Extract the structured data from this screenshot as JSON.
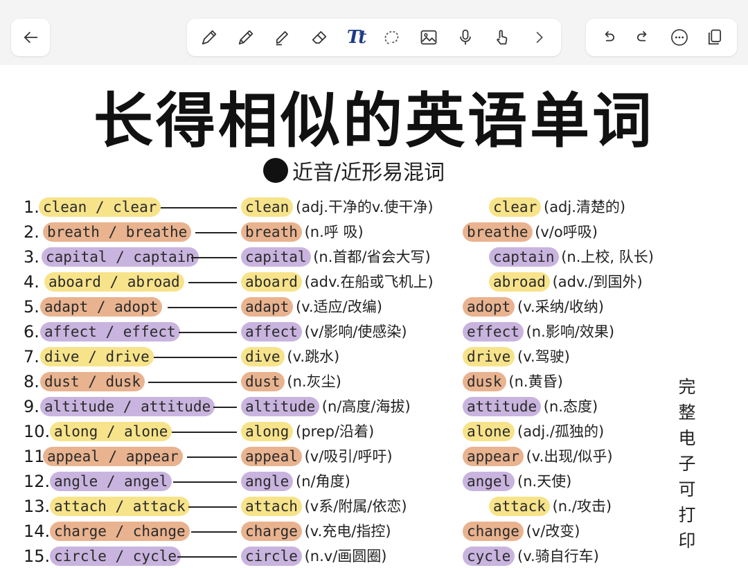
{
  "toolbar": {
    "back_icon": "arrow-left-icon",
    "tools": [
      "pen-icon",
      "pencil-icon",
      "highlighter-icon",
      "eraser-icon",
      "text-icon",
      "lasso-icon",
      "image-icon",
      "microphone-icon",
      "hand-touch-icon",
      "chevron-right-icon"
    ],
    "text_tool_glyph": "Tt",
    "actions": [
      "undo-icon",
      "redo-icon",
      "more-icon",
      "pages-icon"
    ]
  },
  "note": {
    "title": "长得相似的英语单词",
    "subtitle": "近音/近形易混词",
    "side_text": [
      "完",
      "整",
      "电",
      "子",
      "可",
      "打",
      "印"
    ],
    "rows": [
      {
        "num": "1.",
        "pair": "clean / clear",
        "color": "yellow",
        "w1": "clean",
        "g1": "(adj.干净的v.使干净)",
        "w2": "clear",
        "g2": "(adj.清楚的)",
        "c1": "yellow",
        "c2": "yellow"
      },
      {
        "num": "2.",
        "pair": "breath / breathe",
        "color": "orange",
        "w1": "breath",
        "g1": "(n.呼 吸)",
        "w2": "breathe",
        "g2": "(v/o呼吸)",
        "c1": "orange",
        "c2": "orange"
      },
      {
        "num": "3.",
        "pair": "capital / captain",
        "color": "purple",
        "w1": "capital",
        "g1": "(n.首都/省会大写)",
        "w2": "captain",
        "g2": "(n.上校, 队长)",
        "c1": "purple",
        "c2": "purple"
      },
      {
        "num": "4.",
        "pair": "aboard / abroad",
        "color": "yellow",
        "w1": "aboard",
        "g1": "(adv.在船或飞机上)",
        "w2": "abroad",
        "g2": "(adv./到国外)",
        "c1": "yellow",
        "c2": "yellow"
      },
      {
        "num": "5.",
        "pair": "adapt / adopt",
        "color": "orange",
        "w1": "adapt",
        "g1": "(v.适应/改编)",
        "w2": "adopt",
        "g2": "(v.采纳/收纳)",
        "c1": "orange",
        "c2": "orange"
      },
      {
        "num": "6.",
        "pair": "affect / effect",
        "color": "purple",
        "w1": "affect",
        "g1": "(v/影响/使感染)",
        "w2": "effect",
        "g2": "(n.影响/效果)",
        "c1": "purple",
        "c2": "purple"
      },
      {
        "num": "7.",
        "pair": "dive / drive",
        "color": "yellow",
        "w1": "dive",
        "g1": "(v.跳水)",
        "w2": "drive",
        "g2": "(v.驾驶)",
        "c1": "yellow",
        "c2": "yellow"
      },
      {
        "num": "8.",
        "pair": "dust / dusk",
        "color": "orange",
        "w1": "dust",
        "g1": "(n.灰尘)",
        "w2": "dusk",
        "g2": "(n.黄昏)",
        "c1": "orange",
        "c2": "orange"
      },
      {
        "num": "9.",
        "pair": "altitude / attitude",
        "color": "purple",
        "w1": "altitude",
        "g1": "(n/高度/海拔)",
        "w2": "attitude",
        "g2": "(n.态度)",
        "c1": "purple",
        "c2": "purple"
      },
      {
        "num": "10.",
        "pair": "along / alone",
        "color": "yellow",
        "w1": "along",
        "g1": "(prep/沿着)",
        "w2": "alone",
        "g2": "(adj./孤独的)",
        "c1": "yellow",
        "c2": "yellow"
      },
      {
        "num": "11.",
        "pair": "appeal / appear",
        "color": "orange",
        "w1": "appeal",
        "g1": "(v/吸引/呼吁)",
        "w2": "appear",
        "g2": "(v.出现/似乎)",
        "c1": "orange",
        "c2": "orange"
      },
      {
        "num": "12.",
        "pair": "angle / angel",
        "color": "purple",
        "w1": "angle",
        "g1": "(n/角度)",
        "w2": "angel",
        "g2": "(n.天使)",
        "c1": "purple",
        "c2": "purple"
      },
      {
        "num": "13.",
        "pair": "attach / attack",
        "color": "yellow",
        "w1": "attach",
        "g1": "(v系/附属/依恋)",
        "w2": "attack",
        "g2": "(n./攻击)",
        "c1": "yellow",
        "c2": "yellow"
      },
      {
        "num": "14.",
        "pair": "charge / change",
        "color": "orange",
        "w1": "charge",
        "g1": "(v.充电/指控)",
        "w2": "change",
        "g2": "(v/改变)",
        "c1": "orange",
        "c2": "orange"
      },
      {
        "num": "15.",
        "pair": "circle / cycle",
        "color": "purple",
        "w1": "circle",
        "g1": "(n.v/画圆圈)",
        "w2": "cycle",
        "g2": "(v.骑自行车)",
        "c1": "purple",
        "c2": "purple"
      }
    ]
  }
}
